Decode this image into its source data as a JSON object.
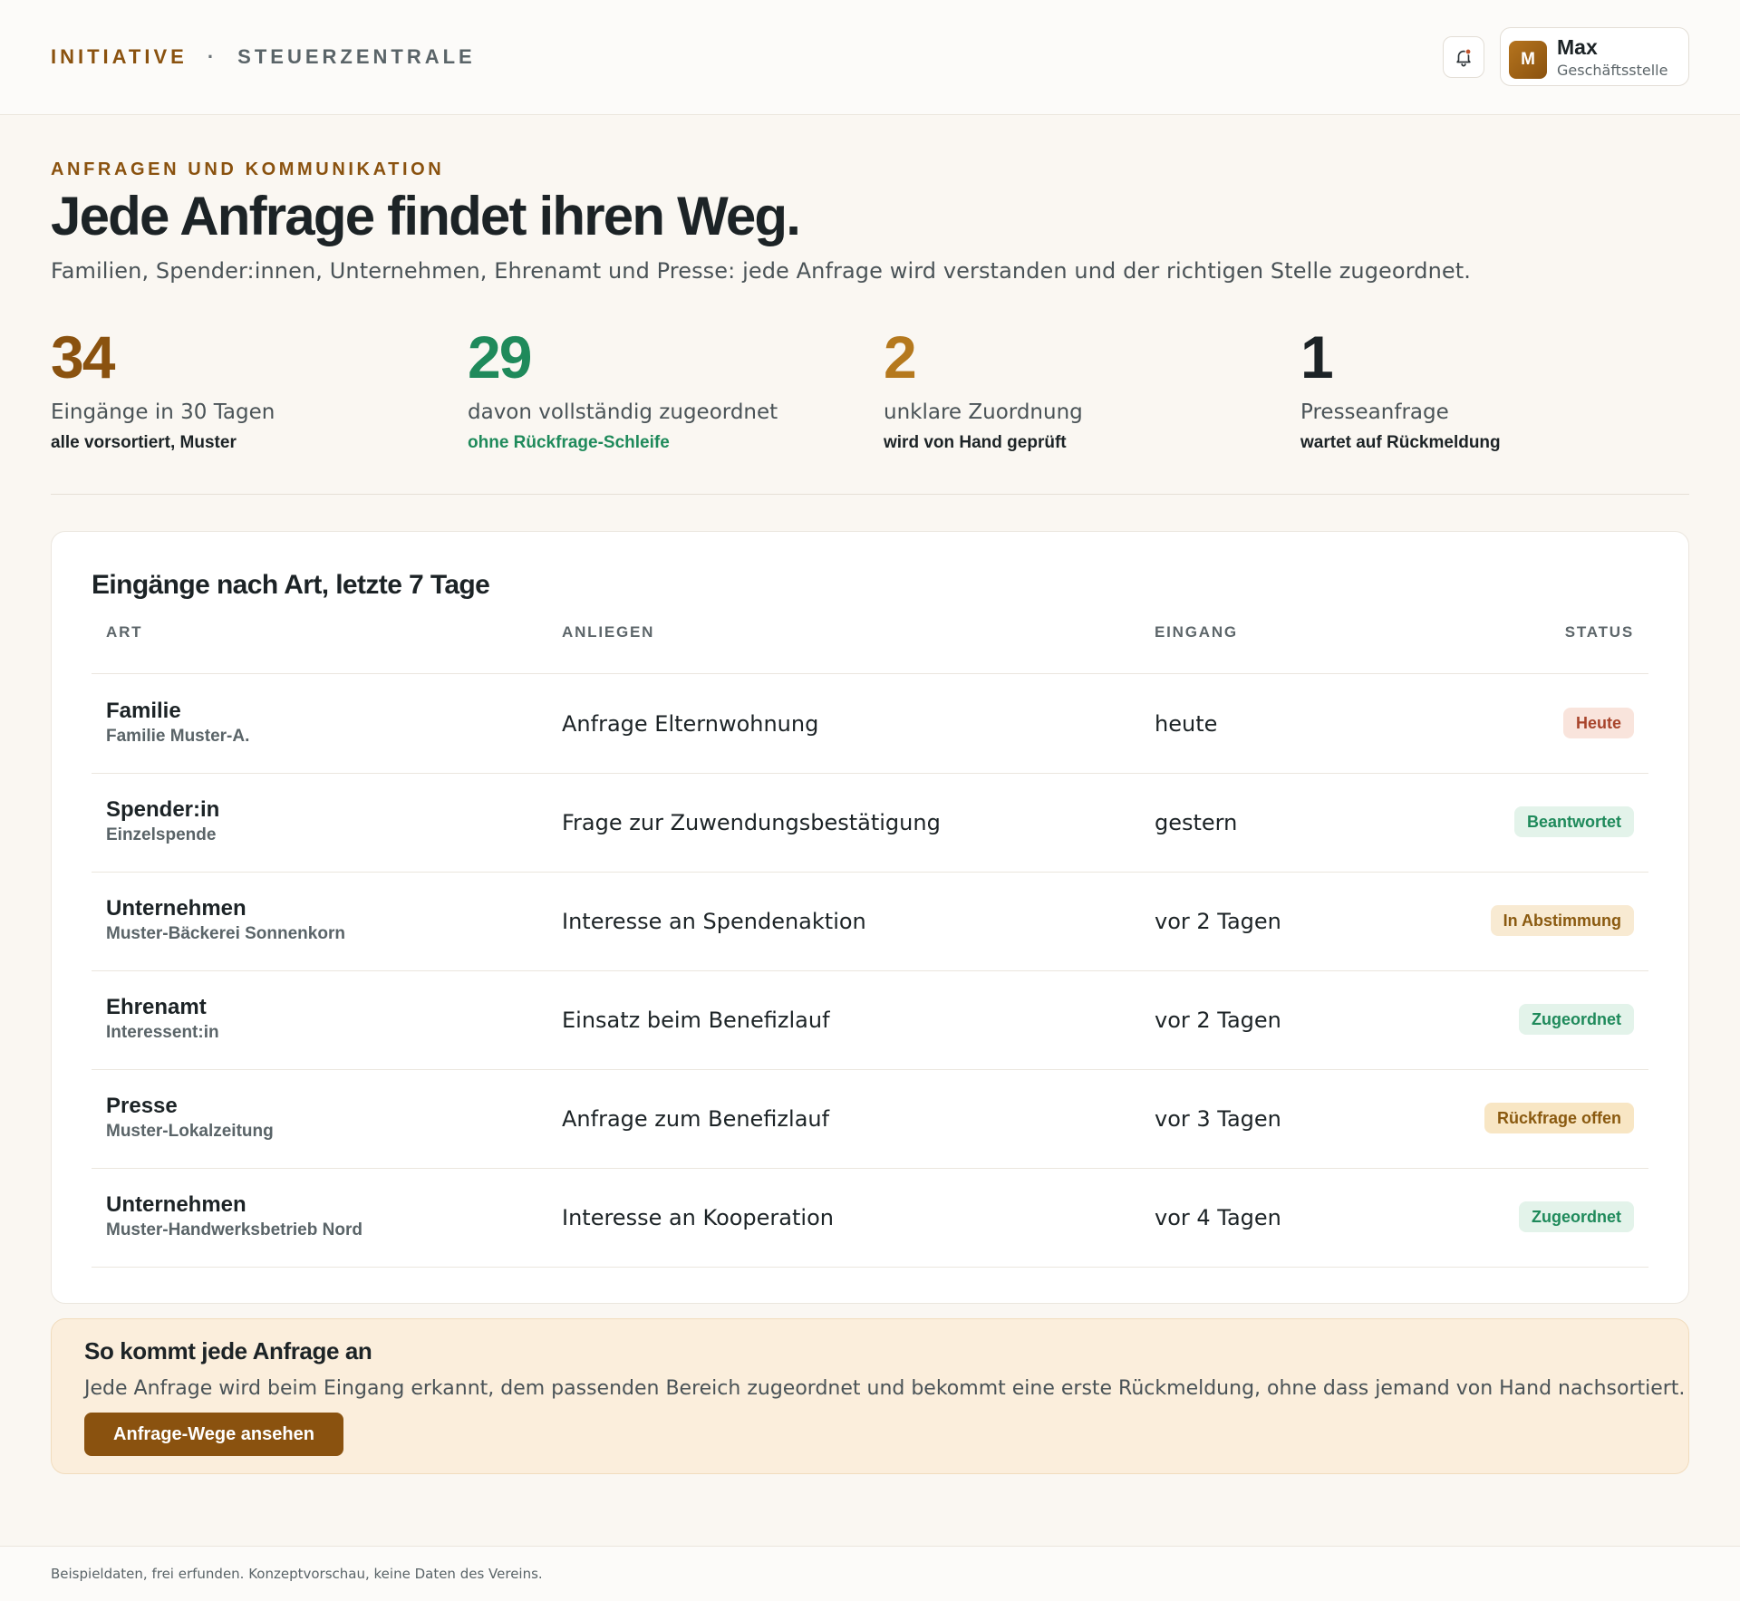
{
  "header": {
    "brand_primary": "INITIATIVE",
    "brand_separator": "·",
    "brand_secondary": "STEUERZENTRALE",
    "notifications_icon": "bell-icon",
    "user": {
      "avatar_initial": "M",
      "name": "Max",
      "role": "Geschäftsstelle"
    }
  },
  "hero": {
    "eyebrow": "ANFRAGEN UND KOMMUNIKATION",
    "title": "Jede Anfrage findet ihren Weg.",
    "subtitle": "Familien, Spender:innen, Unternehmen, Ehrenamt und Presse: jede Anfrage wird verstanden und der richtigen Stelle zugeordnet."
  },
  "kpis": [
    {
      "value": "34",
      "label": "Eingänge in 30 Tagen",
      "sub": "alle vorsortiert, Muster",
      "value_color": "#8a520f",
      "sub_color": "#1c2326"
    },
    {
      "value": "29",
      "label": "davon vollständig zugeordnet",
      "sub": "ohne Rückfrage-Schleife",
      "value_color": "#1f8a5b",
      "sub_color": "#1f8a5b"
    },
    {
      "value": "2",
      "label": "unklare Zuordnung",
      "sub": "wird von Hand geprüft",
      "value_color": "#b5791e",
      "sub_color": "#1c2326"
    },
    {
      "value": "1",
      "label": "Presseanfrage",
      "sub": "wartet auf Rückmeldung",
      "value_color": "#1c2326",
      "sub_color": "#1c2326"
    }
  ],
  "inbox": {
    "title": "Eingänge nach Art, letzte 7 Tage",
    "columns": {
      "art": "ART",
      "anliegen": "ANLIEGEN",
      "eingang": "EINGANG",
      "status": "STATUS"
    },
    "rows": [
      {
        "art": "Familie",
        "meta": "Familie Muster-A.",
        "anliegen": "Anfrage Elternwohnung",
        "eingang": "heute",
        "status": "Heute",
        "status_bg": "#f9e4dc",
        "status_fg": "#a8452c"
      },
      {
        "art": "Spender:in",
        "meta": "Einzelspende",
        "anliegen": "Frage zur Zuwendungsbestätigung",
        "eingang": "gestern",
        "status": "Beantwortet",
        "status_bg": "#e3f3ea",
        "status_fg": "#1f8a5b"
      },
      {
        "art": "Unternehmen",
        "meta": "Muster-Bäckerei Sonnenkorn",
        "anliegen": "Interesse an Spendenaktion",
        "eingang": "vor 2 Tagen",
        "status": "In Abstimmung",
        "status_bg": "#f8ead2",
        "status_fg": "#8a5a10"
      },
      {
        "art": "Ehrenamt",
        "meta": "Interessent:in",
        "anliegen": "Einsatz beim Benefizlauf",
        "eingang": "vor 2 Tagen",
        "status": "Zugeordnet",
        "status_bg": "#e3f3ea",
        "status_fg": "#1f8a5b"
      },
      {
        "art": "Presse",
        "meta": "Muster-Lokalzeitung",
        "anliegen": "Anfrage zum Benefizlauf",
        "eingang": "vor 3 Tagen",
        "status": "Rückfrage offen",
        "status_bg": "#f8e6c4",
        "status_fg": "#8a5a10"
      },
      {
        "art": "Unternehmen",
        "meta": "Muster-Handwerksbetrieb Nord",
        "anliegen": "Interesse an Kooperation",
        "eingang": "vor 4 Tagen",
        "status": "Zugeordnet",
        "status_bg": "#e3f3ea",
        "status_fg": "#1f8a5b"
      }
    ]
  },
  "callout": {
    "title": "So kommt jede Anfrage an",
    "text": "Jede Anfrage wird beim Eingang erkannt, dem passenden Bereich zugeordnet und bekommt eine erste Rückmeldung, ohne dass jemand von Hand nachsortiert.",
    "button_label": "Anfrage-Wege ansehen"
  },
  "footer": {
    "text": "Beispieldaten, frei erfunden. Konzeptvorschau, keine Daten des Vereins."
  },
  "colors": {
    "accent": "#8a520f",
    "success": "#1f8a5b",
    "warning": "#b5791e",
    "background": "#faf7f2"
  }
}
